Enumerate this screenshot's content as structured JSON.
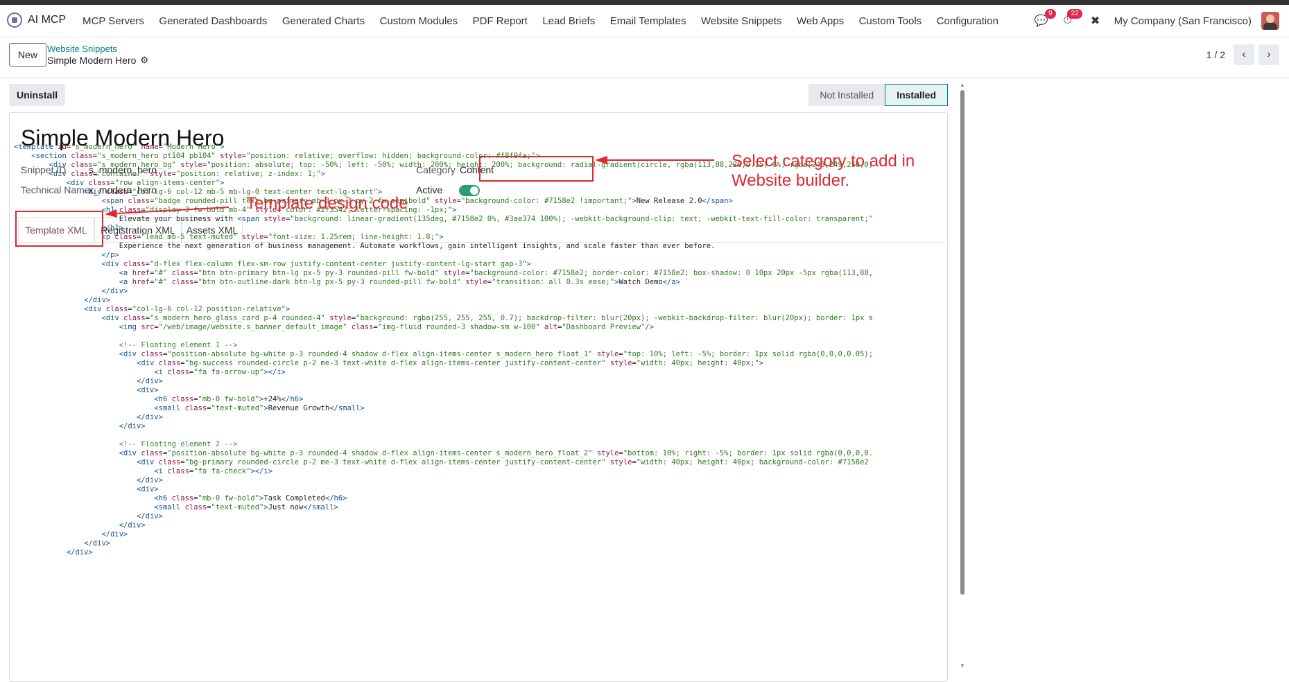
{
  "app": {
    "name": "AI MCP"
  },
  "menu": [
    "MCP Servers",
    "Generated Dashboards",
    "Generated Charts",
    "Custom Modules",
    "PDF Report",
    "Lead Briefs",
    "Email Templates",
    "Website Snippets",
    "Web Apps",
    "Custom Tools",
    "Configuration"
  ],
  "systray": {
    "messages_count": "9",
    "activities_count": "22",
    "company": "My Company (San Francisco)"
  },
  "control": {
    "new_label": "New",
    "breadcrumb_parent": "Website Snippets",
    "breadcrumb_current": "Simple Modern Hero",
    "pager": "1 / 2"
  },
  "actions": {
    "uninstall_label": "Uninstall"
  },
  "status": {
    "options": [
      "Not Installed",
      "Installed"
    ],
    "current": "Installed"
  },
  "record": {
    "title": "Simple Modern Hero",
    "snippet_id_label": "Snippet ID",
    "snippet_id": "s_modern_hero",
    "technical_name_label": "Technical Name",
    "technical_name": "x_modern_hero",
    "category_label": "Category",
    "category": "Content",
    "active_label": "Active",
    "active": true
  },
  "tabs": [
    "Template XML",
    "Registration XML",
    "Assets XML"
  ],
  "active_tab": "Template XML",
  "code_lines": [
    "<template id=\"s_modern_hero\" name=\"Modern Hero\">",
    "    <section class=\"s_modern_hero pt104 pb104\" style=\"position: relative; overflow: hidden; background-color: #f8f9fa;\">",
    "        <div class=\"s_modern_hero_bg\" style=\"position: absolute; top: -50%; left: -50%; width: 200%; height: 200%; background: radial-gradient(circle, rgba(113,88,226,0.15) 0%, rgba(248,249,250,0)",
    "        <div class=\"container\" style=\"position: relative; z-index: 1;\">",
    "            <div class=\"row align-items-center\">",
    "                <div class=\"col-lg-6 col-12 mb-5 mb-lg-0 text-center text-lg-start\">",
    "                    <span class=\"badge rounded-pill text-bg-primary mb-3 px-3 py-2 fw-semibold\" style=\"background-color: #7158e2 !important;\">New Release 2.0</span>",
    "                    <h1 class=\"display-3 fw-bold mb-4\" style=\"color: #2f3542; letter-spacing: -1px;\">",
    "                        Elevate your business with <span style=\"background: linear-gradient(135deg, #7158e2 0%, #3ae374 100%); -webkit-background-clip: text; -webkit-text-fill-color: transparent;\"",
    "                    </h1>",
    "                    <p class=\"lead mb-5 text-muted\" style=\"font-size: 1.25rem; line-height: 1.8;\">",
    "                        Experience the next generation of business management. Automate workflows, gain intelligent insights, and scale faster than ever before.",
    "                    </p>",
    "                    <div class=\"d-flex flex-column flex-sm-row justify-content-center justify-content-lg-start gap-3\">",
    "                        <a href=\"#\" class=\"btn btn-primary btn-lg px-5 py-3 rounded-pill fw-bold\" style=\"background-color: #7158e2; border-color: #7158e2; box-shadow: 0 10px 20px -5px rgba(113,88,",
    "                        <a href=\"#\" class=\"btn btn-outline-dark btn-lg px-5 py-3 rounded-pill fw-bold\" style=\"transition: all 0.3s ease;\">Watch Demo</a>",
    "                    </div>",
    "                </div>",
    "                <div class=\"col-lg-6 col-12 position-relative\">",
    "                    <div class=\"s_modern_hero_glass_card p-4 rounded-4\" style=\"background: rgba(255, 255, 255, 0.7); backdrop-filter: blur(20px); -webkit-backdrop-filter: blur(20px); border: 1px s",
    "                        <img src=\"/web/image/website.s_banner_default_image\" class=\"img-fluid rounded-3 shadow-sm w-100\" alt=\"Dashboard Preview\"/>",
    "",
    "                        <!-- Floating element 1 -->",
    "                        <div class=\"position-absolute bg-white p-3 rounded-4 shadow d-flex align-items-center s_modern_hero_float_1\" style=\"top: 10%; left: -5%; border: 1px solid rgba(0,0,0,0.05);",
    "                            <div class=\"bg-success rounded-circle p-2 me-3 text-white d-flex align-items-center justify-content-center\" style=\"width: 40px; height: 40px;\">",
    "                                <i class=\"fa fa-arrow-up\"></i>",
    "                            </div>",
    "                            <div>",
    "                                <h6 class=\"mb-0 fw-bold\">+24%</h6>",
    "                                <small class=\"text-muted\">Revenue Growth</small>",
    "                            </div>",
    "                        </div>",
    "",
    "                        <!-- Floating element 2 -->",
    "                        <div class=\"position-absolute bg-white p-3 rounded-4 shadow d-flex align-items-center s_modern_hero_float_2\" style=\"bottom: 10%; right: -5%; border: 1px solid rgba(0,0,0,0.",
    "                            <div class=\"bg-primary rounded-circle p-2 me-3 text-white d-flex align-items-center justify-content-center\" style=\"width: 40px; height: 40px; background-color: #7158e2",
    "                                <i class=\"fa fa-check\"></i>",
    "                            </div>",
    "                            <div>",
    "                                <h6 class=\"mb-0 fw-bold\">Task Completed</h6>",
    "                                <small class=\"text-muted\">Just now</small>",
    "                            </div>",
    "                        </div>",
    "                    </div>",
    "                </div>",
    "            </div>"
  ],
  "annotations": {
    "category_note": "Select category to add in Website builder.",
    "template_note": "Template design code"
  },
  "colors": {
    "annotation": "#e0262f",
    "accent": "#017e84",
    "toggle_on": "#2aa06e"
  }
}
